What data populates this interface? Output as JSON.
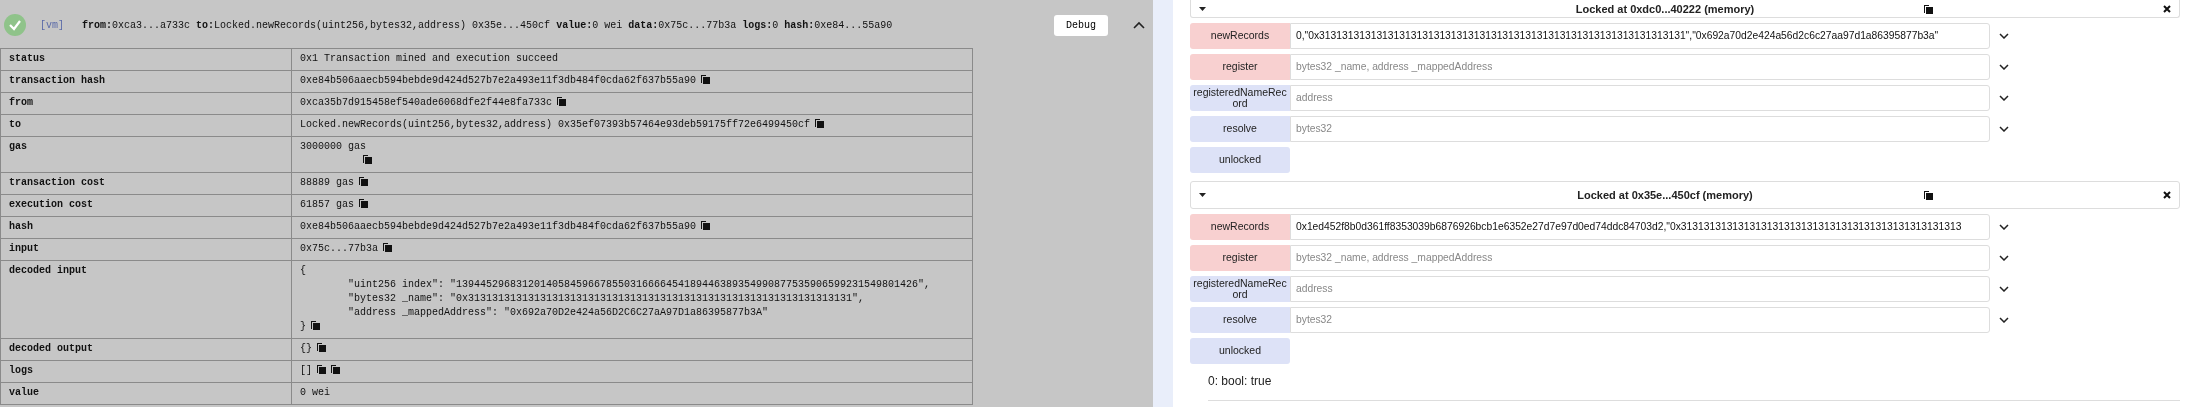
{
  "transaction": {
    "status_ok": true,
    "network": "[vm]",
    "summary": [
      {
        "label": "from:",
        "value": "0xca3...a733c"
      },
      {
        "label": "to:",
        "value": "Locked.newRecords(uint256,bytes32,address) 0x35e...450cf"
      },
      {
        "label": "value:",
        "value": "0 wei"
      },
      {
        "label": "data:",
        "value": "0x75c...77b3a"
      },
      {
        "label": "logs:",
        "value": "0"
      },
      {
        "label": "hash:",
        "value": "0xe84...55a90"
      }
    ],
    "debug_button": "Debug",
    "expanded": true,
    "rows": [
      {
        "label": "status",
        "kind": "plain",
        "value": "0x1 Transaction mined and execution succeed"
      },
      {
        "label": "transaction hash",
        "kind": "copy",
        "value": "0xe84b506aaecb594bebde9d424d527b7e2a493e11f3db484f0cda62f637b55a90"
      },
      {
        "label": "from",
        "kind": "copy",
        "value": "0xca35b7d915458ef540ade6068dfe2f44e8fa733c"
      },
      {
        "label": "to",
        "kind": "copy",
        "value": "Locked.newRecords(uint256,bytes32,address) 0x35ef07393b57464e93deb59175ff72e6499450cf"
      },
      {
        "label": "gas",
        "kind": "copy-below",
        "value": "3000000 gas"
      },
      {
        "label": "transaction cost",
        "kind": "copy",
        "value": "88889 gas"
      },
      {
        "label": "execution cost",
        "kind": "copy",
        "value": "61857 gas"
      },
      {
        "label": "hash",
        "kind": "copy",
        "value": "0xe84b506aaecb594bebde9d424d527b7e2a493e11f3db484f0cda62f637b55a90"
      },
      {
        "label": "input",
        "kind": "copy",
        "value": "0x75c...77b3a"
      },
      {
        "label": "decoded input",
        "kind": "block",
        "lines": [
          "{",
          "\"uint256 index\": \"13944529683120140584596678550316666454189446389354990877535906599231549801426\",",
          "\"bytes32 _name\": \"0x3131313131313131313131313131313131313131313131313131313131313131\",",
          "\"address _mappedAddress\": \"0x692a70D2e424a56D2C6C27aA97D1a86395877b3A\"",
          "}"
        ]
      },
      {
        "label": "decoded output",
        "kind": "copy",
        "value": "{}"
      },
      {
        "label": "logs",
        "kind": "logs",
        "value": "[]"
      },
      {
        "label": "value",
        "kind": "plain",
        "value": "0 wei"
      }
    ]
  },
  "instances": [
    {
      "title": "Locked at 0xdc0...40222 (memory)",
      "expanded": true,
      "functions": [
        {
          "name": "newRecords",
          "kind": "transact",
          "value": "0,\"0x3131313131313131313131313131313131313131313131313131313131313131\",\"0x692a70d2e424a56d2c6c27aa97d1a86395877b3a\""
        },
        {
          "name": "register",
          "kind": "transact",
          "placeholder": "bytes32 _name, address _mappedAddress"
        },
        {
          "name": "registeredNameRecord",
          "kind": "call",
          "placeholder": "address"
        },
        {
          "name": "resolve",
          "kind": "call",
          "placeholder": "bytes32"
        },
        {
          "name": "unlocked",
          "kind": "call-noarg"
        }
      ]
    },
    {
      "title": "Locked at 0x35e...450cf (memory)",
      "expanded": true,
      "functions": [
        {
          "name": "newRecords",
          "kind": "transact",
          "value": "0x1ed452f8b0d361ff8353039b6876926bcb1e6352e27d7e97d0ed74ddc84703d2,\"0x3131313131313131313131313131313131313131313131313"
        },
        {
          "name": "register",
          "kind": "transact",
          "placeholder": "bytes32 _name, address _mappedAddress"
        },
        {
          "name": "registeredNameRecord",
          "kind": "call",
          "placeholder": "address"
        },
        {
          "name": "resolve",
          "kind": "call",
          "placeholder": "bytes32"
        },
        {
          "name": "unlocked",
          "kind": "call-noarg"
        }
      ],
      "result": "0: bool: true"
    }
  ]
}
